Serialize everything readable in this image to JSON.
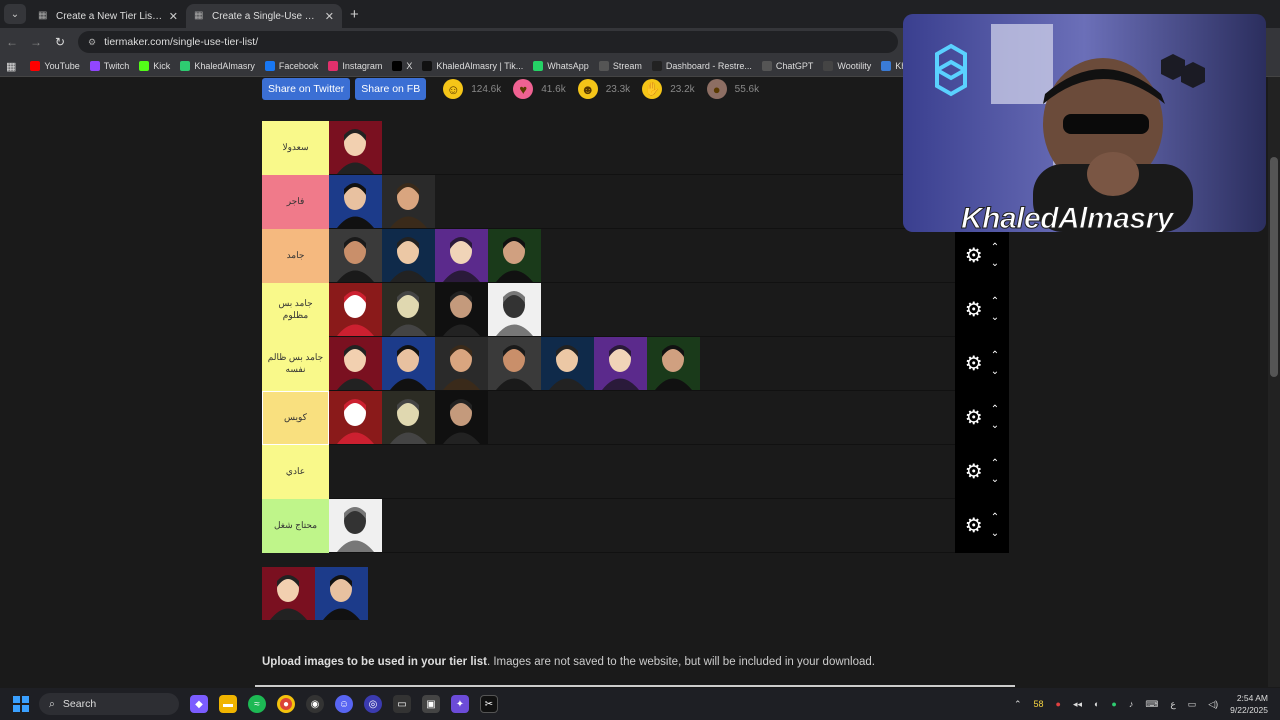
{
  "browser": {
    "tabs": [
      {
        "title": "Create a New Tier List - TierMaker",
        "active": false
      },
      {
        "title": "Create a Single-Use Tier List (P...",
        "active": true
      }
    ],
    "url": "tiermaker.com/single-use-tier-list/",
    "bookmarks": [
      {
        "label": "YouTube",
        "icon": "youtube-icon",
        "color": "#ff0000"
      },
      {
        "label": "Twitch",
        "icon": "twitch-icon",
        "color": "#9146ff"
      },
      {
        "label": "Kick",
        "icon": "kick-icon",
        "color": "#53fc18"
      },
      {
        "label": "KhaledAlmasry",
        "icon": "site-icon",
        "color": "#2ecc71"
      },
      {
        "label": "Facebook",
        "icon": "facebook-icon",
        "color": "#1877f2"
      },
      {
        "label": "Instagram",
        "icon": "instagram-icon",
        "color": "#e1306c"
      },
      {
        "label": "X",
        "icon": "x-icon",
        "color": "#000000"
      },
      {
        "label": "KhaledAlmasry | Tik...",
        "icon": "tiktok-icon",
        "color": "#111111"
      },
      {
        "label": "WhatsApp",
        "icon": "whatsapp-icon",
        "color": "#25d366"
      },
      {
        "label": "Stream",
        "icon": "folder-icon",
        "color": "#555555"
      },
      {
        "label": "Dashboard - Restre...",
        "icon": "restream-icon",
        "color": "#222222"
      },
      {
        "label": "ChatGPT",
        "icon": "chatgpt-icon",
        "color": "#555555"
      },
      {
        "label": "Wootility",
        "icon": "wootility-icon",
        "color": "#444444"
      },
      {
        "label": "KhaledAlmas",
        "icon": "site-icon",
        "color": "#3a7bd5"
      }
    ]
  },
  "share": {
    "twitter_label": "Share on Twitter",
    "fb_label": "Share on FB",
    "reactions": [
      {
        "icon": "smile-emoji-icon",
        "glyph": "☺",
        "count": "124.6k",
        "color": "#f5c518"
      },
      {
        "icon": "heart-eyes-emoji-icon",
        "glyph": "♥",
        "count": "41.6k",
        "color": "#f06292"
      },
      {
        "icon": "laugh-emoji-icon",
        "glyph": "☻",
        "count": "23.3k",
        "color": "#f5c518"
      },
      {
        "icon": "pray-emoji-icon",
        "glyph": "✋",
        "count": "23.2k",
        "color": "#f5c518"
      },
      {
        "icon": "poop-emoji-icon",
        "glyph": "●",
        "count": "55.6k",
        "color": "#8d6e63"
      }
    ]
  },
  "tiers": [
    {
      "label": "سعدولا",
      "color": "#f9f98a",
      "items": 1
    },
    {
      "label": "فاجر",
      "color": "#f07a8a",
      "items": 2
    },
    {
      "label": "جامد",
      "color": "#f5b97f",
      "items": 4
    },
    {
      "label": "جامد بس مظلوم",
      "color": "#f9f98a",
      "items": 4
    },
    {
      "label": "جامد بس ظالم نفسه",
      "color": "#f9f98a",
      "items": 7
    },
    {
      "label": "كويس",
      "color": "#f9e07f",
      "items": 3
    },
    {
      "label": "عادي",
      "color": "#f9f98a",
      "items": 0
    },
    {
      "label": "محتاج شغل",
      "color": "#bff58a",
      "items": 1
    }
  ],
  "upload": {
    "bold": "Upload images to be used in your tier list",
    "rest": ". Images are not saved to the website, but will be included in your download."
  },
  "webcam": {
    "name": "KhaledAlmasry"
  },
  "taskbar": {
    "search_label": "Search",
    "tray_badge": "58",
    "lang": "ع",
    "time": "2:54 AM",
    "date": "9/22/2025"
  }
}
